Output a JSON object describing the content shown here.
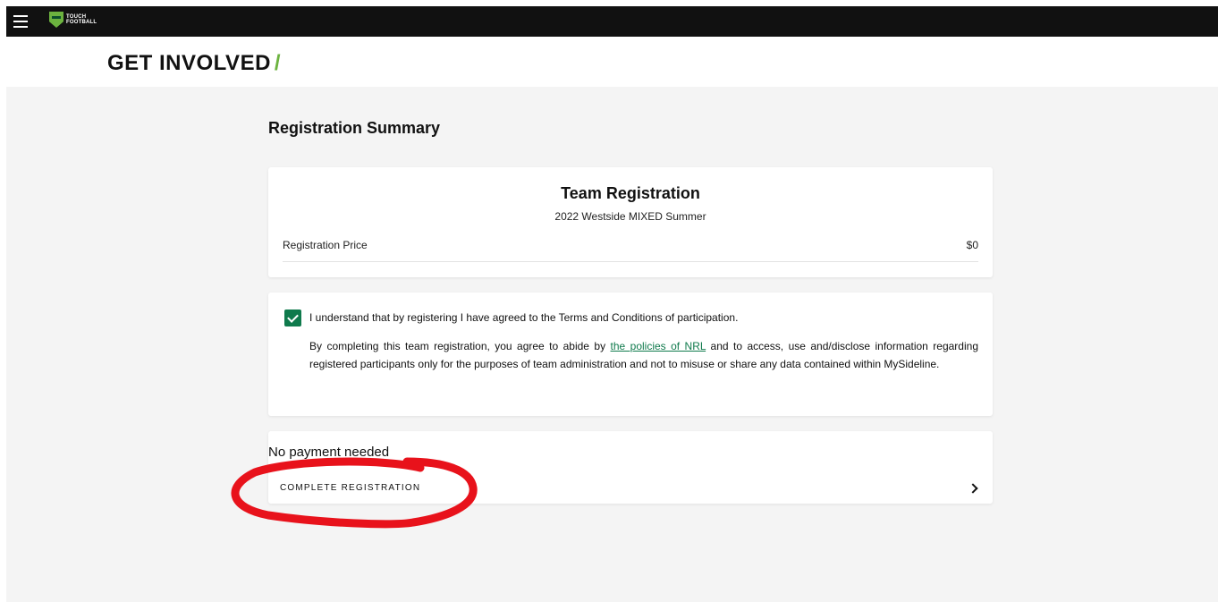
{
  "brand": {
    "logo_text_line1": "TOUCH",
    "logo_text_line2": "FOOTBALL",
    "accent_color": "#6cb33f"
  },
  "header": {
    "title": "GET INVOLVED",
    "slash": "/"
  },
  "page": {
    "section_title": "Registration Summary"
  },
  "summary": {
    "title": "Team Registration",
    "subtitle": "2022 Westside MIXED Summer",
    "price_label": "Registration Price",
    "price_value": "$0"
  },
  "terms": {
    "checked": true,
    "checkbox_label": "I understand that by registering I have agreed to the Terms and Conditions of participation.",
    "para_before": "By completing this team registration, you agree to abide by ",
    "link_text": "the policies of NRL",
    "para_after": " and to access, use and/disclose information regarding registered participants only for the purposes of team administration and not to misuse or share any data contained within MySideline."
  },
  "payment": {
    "heading": "No payment needed",
    "action_label": "COMPLETE REGISTRATION"
  },
  "icons": {
    "menu": "hamburger-icon",
    "logo": "touch-football-logo",
    "check": "check-icon",
    "chevron": "chevron-right-icon"
  },
  "annotation_color": "#e8121b"
}
